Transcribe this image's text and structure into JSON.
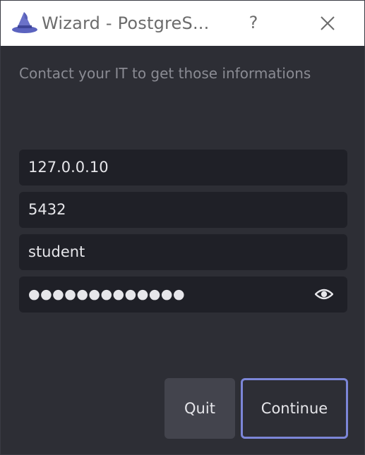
{
  "window": {
    "title": "Wizard - PostgreS...",
    "help_label": "?",
    "icons": {
      "app": "wizard-hat-icon",
      "close": "close-icon"
    }
  },
  "info_text": "Contact your IT to get those informations",
  "fields": {
    "host": "127.0.0.10",
    "port": "5432",
    "username": "student",
    "password_mask": "●●●●●●●●●●●●●"
  },
  "password_toggle_icon": "eye-icon",
  "buttons": {
    "quit": "Quit",
    "continue": "Continue"
  },
  "colors": {
    "accent": "#7c86d8",
    "background": "#2d2e35",
    "field_background": "#1f2027"
  }
}
